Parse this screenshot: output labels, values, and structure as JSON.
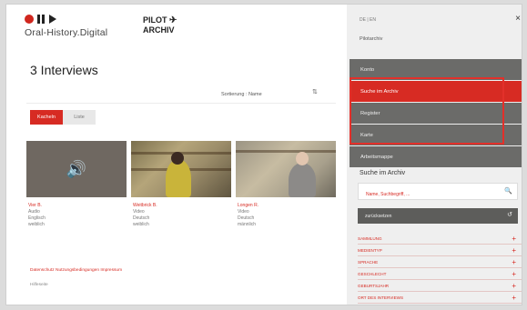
{
  "header": {
    "logo_text": "Oral-History.Digital",
    "pilot_line1": "PILOT",
    "pilot_line2": "ARCHIV",
    "plane_icon": "✈"
  },
  "main": {
    "title": "3 Interviews",
    "sort_label": "Sortierung : Name",
    "sort_icon": "⇅",
    "view_tabs": [
      "Kacheln",
      "Liste"
    ],
    "cards": [
      {
        "name": "Vier B.",
        "type": "Audio",
        "language": "Englisch",
        "gender": "weiblich"
      },
      {
        "name": "Weitbrick B.",
        "type": "Video",
        "language": "Deutsch",
        "gender": "weiblich"
      },
      {
        "name": "Longen R.",
        "type": "Video",
        "language": "Deutsch",
        "gender": "männlich"
      }
    ],
    "footer_links": "Datenschutz   Nutzungsbedingungen   Impressum",
    "footer_note": "Hilfeseite"
  },
  "sidebar": {
    "lang": "DE | EN",
    "close_icon": "×",
    "subtitle": "Pilotarchiv",
    "menu": [
      "Konto",
      "Suche im Archiv",
      "Register",
      "Karte",
      "Arbeitsmappe"
    ],
    "section_title": "Suche im Archiv",
    "search_placeholder": "Name, Suchbegriff, ...",
    "search_icon": "🔍",
    "reset_label": "zurücksetzen",
    "reset_icon": "↺",
    "filters": [
      "SAMMLUNG",
      "MEDIENTYP",
      "SPRACHE",
      "GESCHLECHT",
      "GEBURTSJAHR",
      "ORT DES INTERVIEWS"
    ]
  },
  "colors": {
    "accent": "#d72b23",
    "menu_bg": "#6b6b69"
  }
}
